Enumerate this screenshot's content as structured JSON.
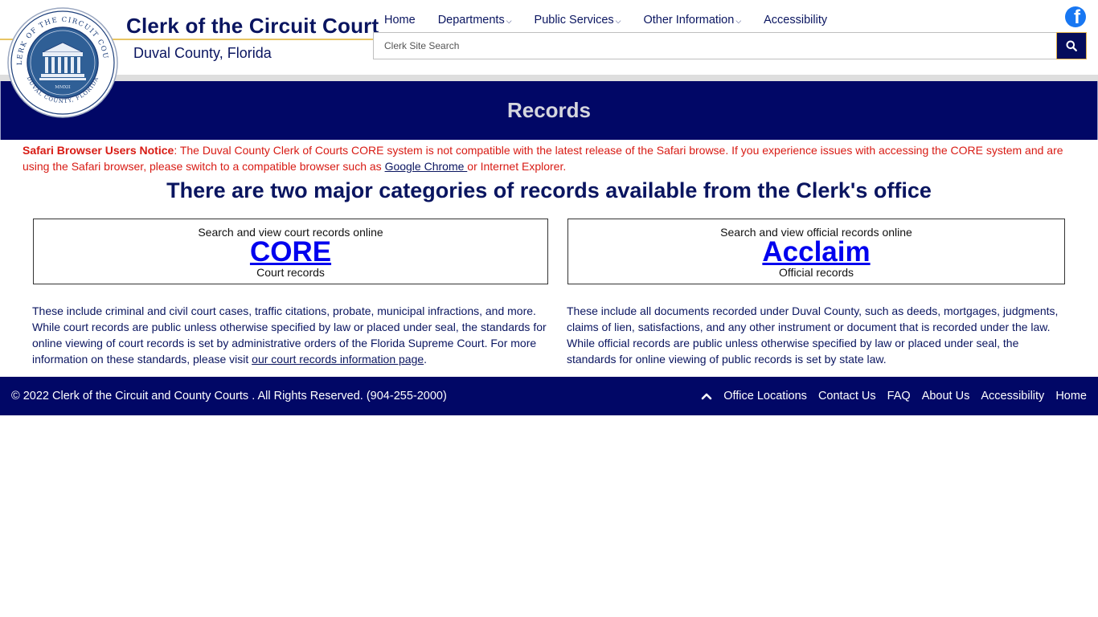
{
  "header": {
    "title": "Clerk of the Circuit Court",
    "subtitle": "Duval County, Florida",
    "seal": {
      "top_text": "CLERK OF THE CIRCUIT COURT",
      "bottom_text": "DUVAL COUNTY, FLORIDA",
      "year": "MMXII"
    }
  },
  "nav": {
    "items": [
      {
        "label": "Home",
        "dropdown": false
      },
      {
        "label": "Departments",
        "dropdown": true
      },
      {
        "label": "Public Services",
        "dropdown": true
      },
      {
        "label": "Other Information",
        "dropdown": true
      },
      {
        "label": "Accessibility",
        "dropdown": false
      }
    ]
  },
  "social": {
    "facebook_icon": "facebook-icon"
  },
  "search": {
    "placeholder": "Clerk Site Search",
    "value": "",
    "icon": "search-icon"
  },
  "banner": {
    "title": "Records"
  },
  "notice": {
    "heading": "Safari Browser Users Notice",
    "text_before_link": ": The Duval County Clerk of Courts CORE system is not compatible with the latest release of the Safari browse. If you experience issues with accessing the CORE system and are using the Safari browser, please switch to a compatible browser such as ",
    "link": "Google Chrome ",
    "text_after_link": "or Internet Explorer."
  },
  "main": {
    "heading": "There are two major categories of records available from the Clerk's office",
    "cards": [
      {
        "pre": "Search and view court records online",
        "link": "CORE",
        "post": "Court records",
        "description_before_link": "These include criminal and civil court cases, traffic citations, probate, municipal infractions, and more. While court records are public unless otherwise specified by law or placed under seal, the standards for online viewing of court records is set by administrative orders of the Florida Supreme Court. For more information on these standards, please visit ",
        "description_link": "our court records information page",
        "description_after_link": "."
      },
      {
        "pre": "Search and view official records online",
        "link": "Acclaim",
        "post": "Official records",
        "description": "These include all documents recorded under Duval County, such as deeds, mortgages, judgments, claims of lien, satisfactions, and any other instrument or document that is recorded under the law. While official records are public unless otherwise specified by law or placed under seal, the standards for online viewing of public records is set by state law."
      }
    ]
  },
  "footer": {
    "copyright": "© 2022 Clerk of the Circuit and County Courts . All Rights Reserved. (904-255-2000)",
    "links": [
      "Office Locations",
      "Contact Us",
      "FAQ",
      "About Us",
      "Accessibility",
      "Home"
    ]
  },
  "colors": {
    "navy": "#010766",
    "title_navy": "#0a1560",
    "notice_red": "#d81b14",
    "link_blue": "#0000ee",
    "gold": "#e8c463",
    "facebook_blue": "#1877f2"
  }
}
